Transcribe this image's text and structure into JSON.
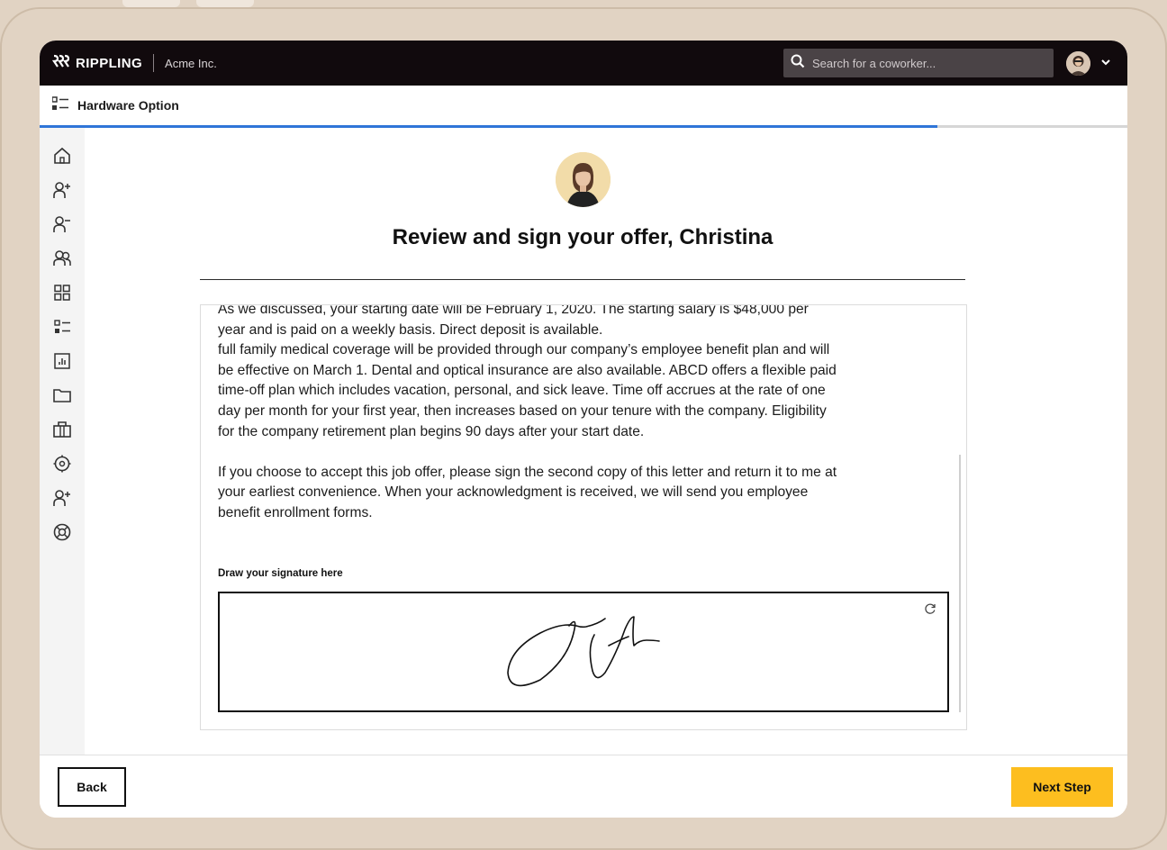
{
  "app": {
    "brand": "RIPPLING",
    "company": "Acme Inc."
  },
  "search": {
    "placeholder": "Search for a coworker..."
  },
  "page": {
    "title": "Hardware Option",
    "progress_fraction": 0.825
  },
  "sidebar": {
    "icons": [
      "home-icon",
      "add-person-icon",
      "remove-person-icon",
      "team-icon",
      "apps-grid-icon",
      "list-icon",
      "reports-icon",
      "folder-icon",
      "briefcase-icon",
      "settings-icon",
      "add-person-icon",
      "help-icon"
    ]
  },
  "offer": {
    "heading": "Review and sign your offer, Christina",
    "paragraphs": [
      "As we discussed, your starting date will be February 1, 2020. The starting salary is $48,000 per year and is paid on a weekly basis. Direct deposit is available.",
      "full family medical coverage will be provided through our company’s employee benefit plan and will be effective on March 1. Dental and optical insurance are also available. ABCD offers a flexible paid time-off plan which includes vacation, personal, and sick leave. Time off accrues at the rate of one day per month for your first year, then increases based on your tenure with the company. Eligibility for the company retirement plan begins 90 days after your start date.",
      "If you choose to accept this job offer, please sign the second copy of this letter and return it to me at your earliest convenience. When your acknowledgment is received, we will send you employee benefit enrollment forms."
    ],
    "signature_label": "Draw your signature here"
  },
  "footer": {
    "back_label": "Back",
    "next_label": "Next Step"
  },
  "colors": {
    "topbar": "#110a0d",
    "progress": "#2f75d8",
    "next_button": "#fdbe1f",
    "frame": "#e1d3c3"
  }
}
